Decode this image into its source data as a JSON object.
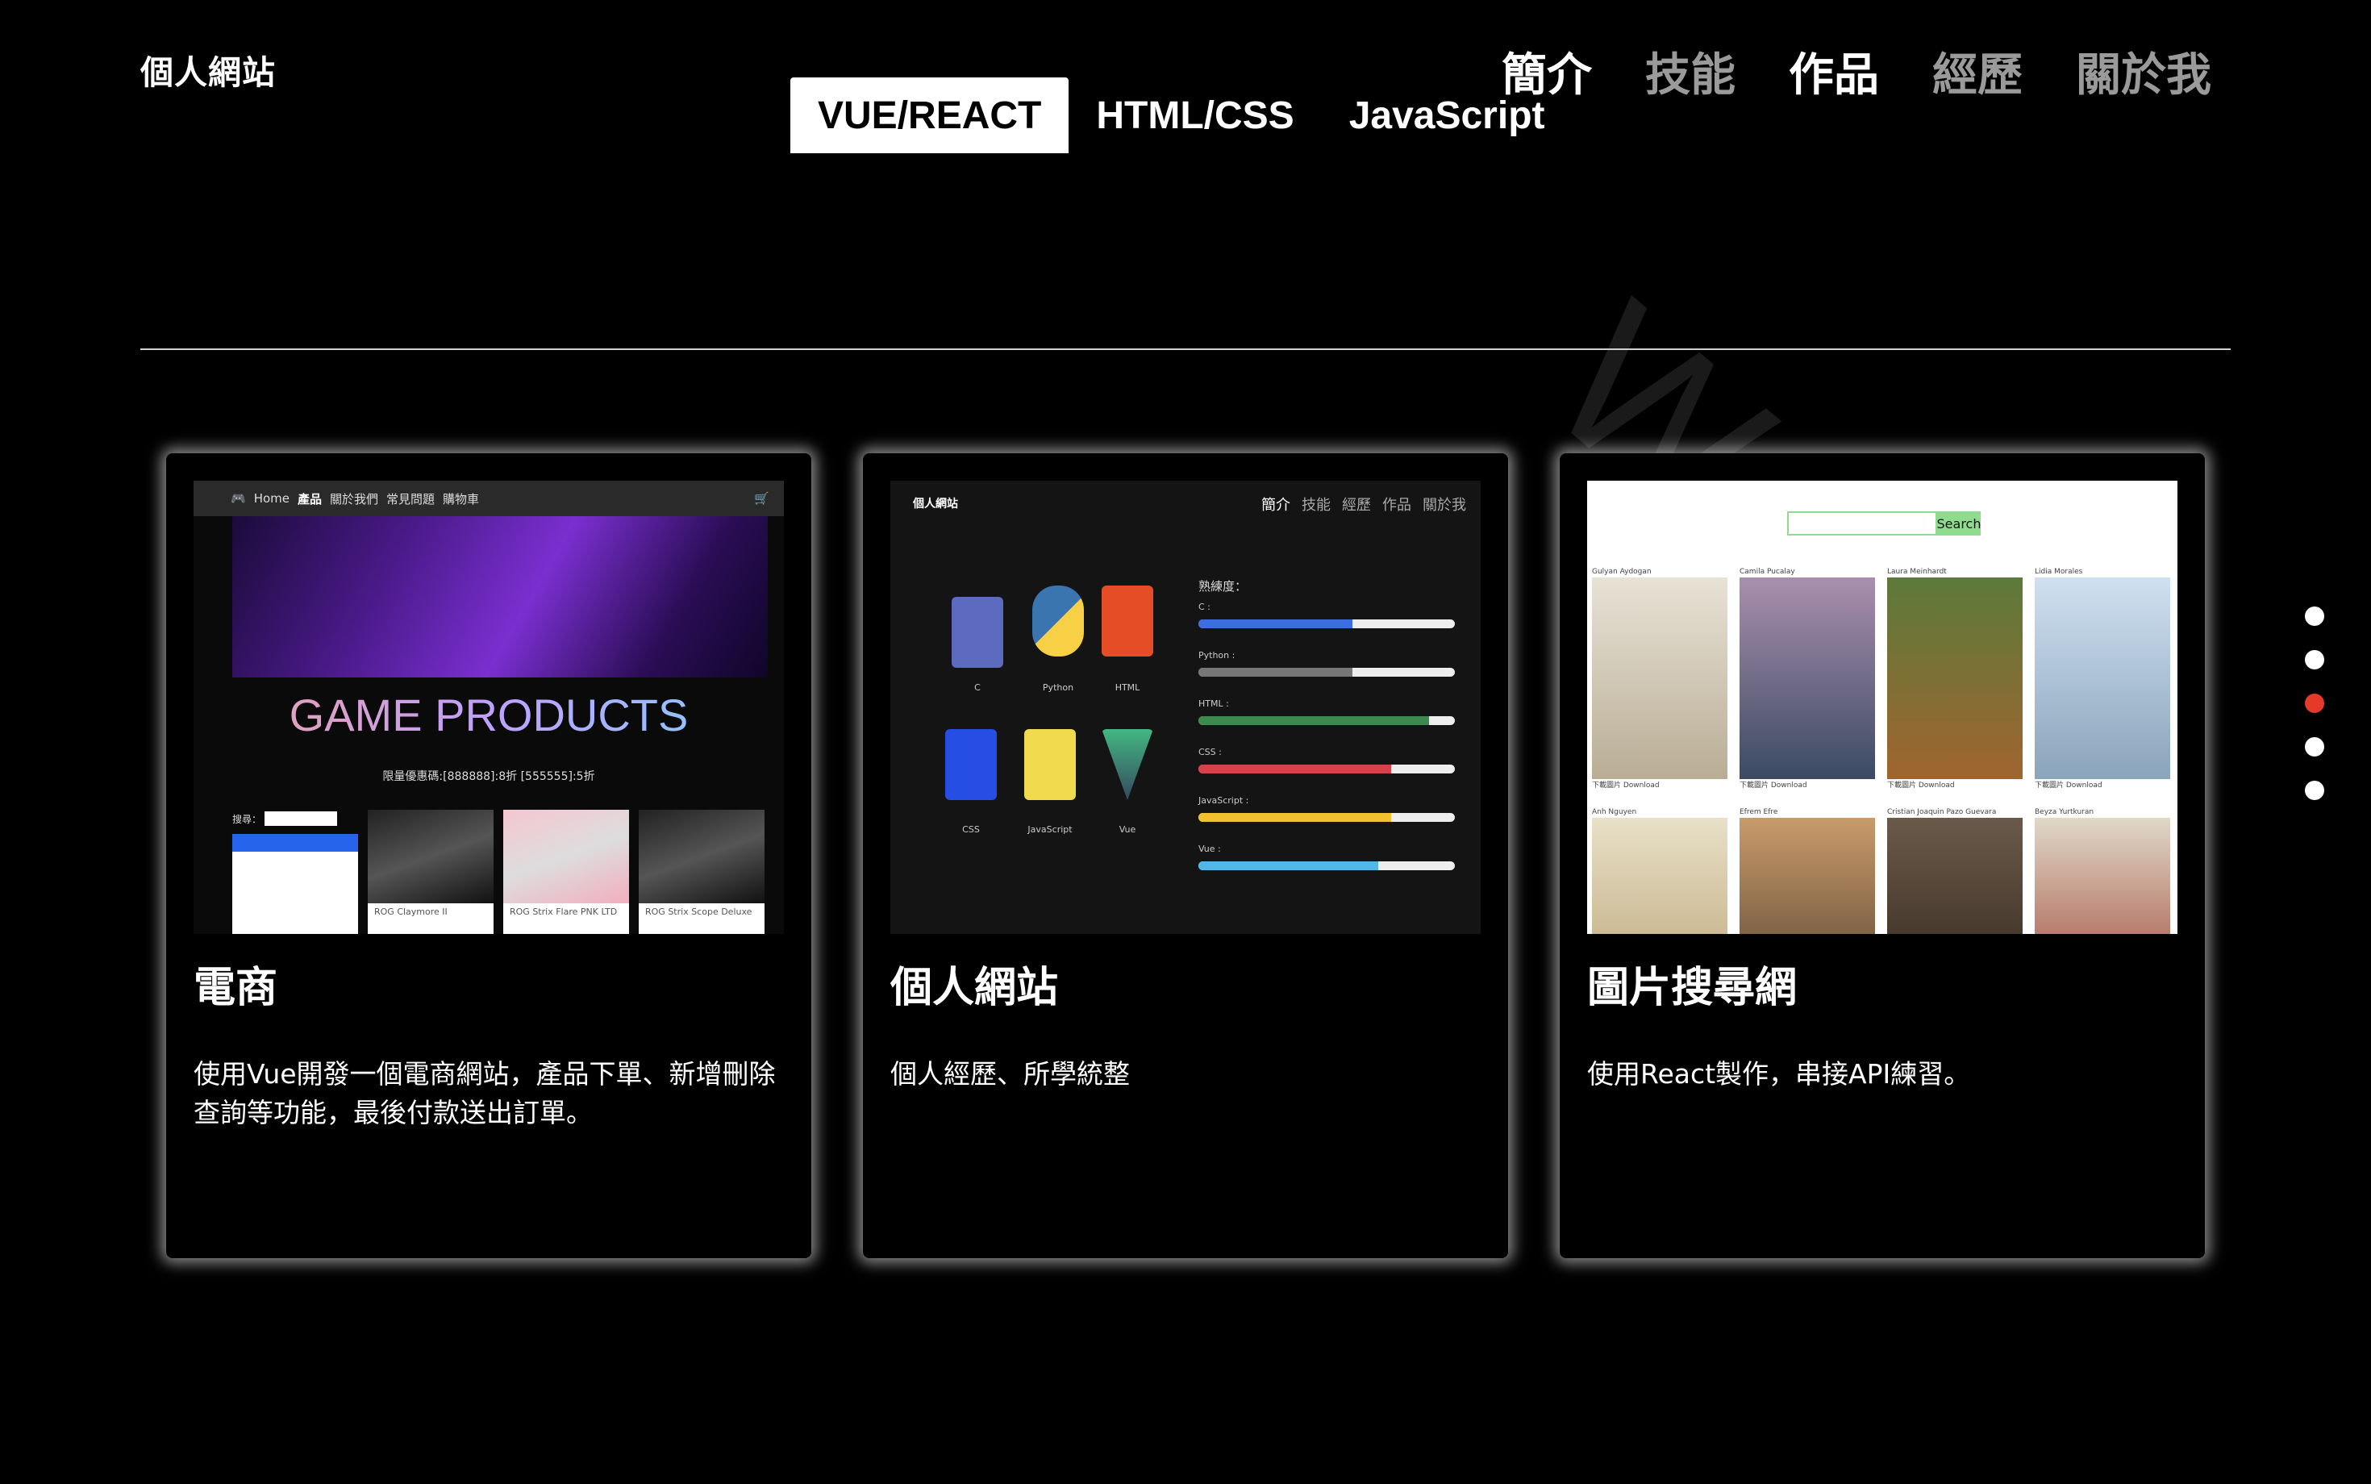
{
  "site": {
    "title": "個人網站"
  },
  "main_nav": [
    {
      "label": "簡介",
      "active": true
    },
    {
      "label": "技能",
      "active": false
    },
    {
      "label": "作品",
      "active": true
    },
    {
      "label": "經歷",
      "active": false
    },
    {
      "label": "關於我",
      "active": false
    }
  ],
  "watermark": "WORK",
  "tabs": [
    {
      "label": "VUE/REACT",
      "active": true
    },
    {
      "label": "HTML/CSS",
      "active": false
    },
    {
      "label": "JavaScript",
      "active": false
    }
  ],
  "cards": [
    {
      "title": "電商",
      "description": "使用Vue開發一個電商網站，產品下單、新增刪除查詢等功能，最後付款送出訂單。",
      "thumb": {
        "nav": [
          "Home",
          "產品",
          "關於我們",
          "常見問題",
          "購物車"
        ],
        "headline": "GAME PRODUCTS",
        "promo": "限量優惠碼:[888888]:8折 [555555]:5折",
        "search_label": "搜尋：",
        "products": [
          "ROG Claymore II",
          "ROG Strix Flare PNK LTD",
          "ROG Strix Scope Deluxe"
        ]
      }
    },
    {
      "title": "個人網站",
      "description": "個人經歷、所學統整",
      "thumb": {
        "site_title": "個人網站",
        "nav": [
          "簡介",
          "技能",
          "經歷",
          "作品",
          "關於我"
        ],
        "proficiency_label": "熟練度：",
        "languages": [
          {
            "name": "C",
            "level": 0.6,
            "color": "#3b6fe0"
          },
          {
            "name": "Python",
            "level": 0.6,
            "color": "#777777"
          },
          {
            "name": "HTML",
            "level": 0.9,
            "color": "#3c8a4f"
          },
          {
            "name": "CSS",
            "level": 0.75,
            "color": "#d8404a"
          },
          {
            "name": "JavaScript",
            "level": 0.75,
            "color": "#f2c12e"
          },
          {
            "name": "Vue",
            "level": 0.7,
            "color": "#4fb8e8"
          }
        ]
      }
    },
    {
      "title": "圖片搜尋網",
      "description": "使用React製作，串接API練習。",
      "thumb": {
        "search_button": "Search",
        "photographers": [
          "Gulyan Aydogan",
          "Camila Pucalay",
          "Laura Meinhardt",
          "Lidia Morales",
          "Anh Nguyen",
          "Efrem Efre",
          "Cristian Joaquin Pazo Guevara",
          "Beyza Yurtkuran"
        ],
        "download_label": "下載圖片 Download"
      }
    }
  ],
  "pager": {
    "count": 5,
    "active_index": 2
  },
  "colors": {
    "accent": "#e53a2a",
    "background": "#000000",
    "inactive_nav": "#9a9a9a"
  }
}
